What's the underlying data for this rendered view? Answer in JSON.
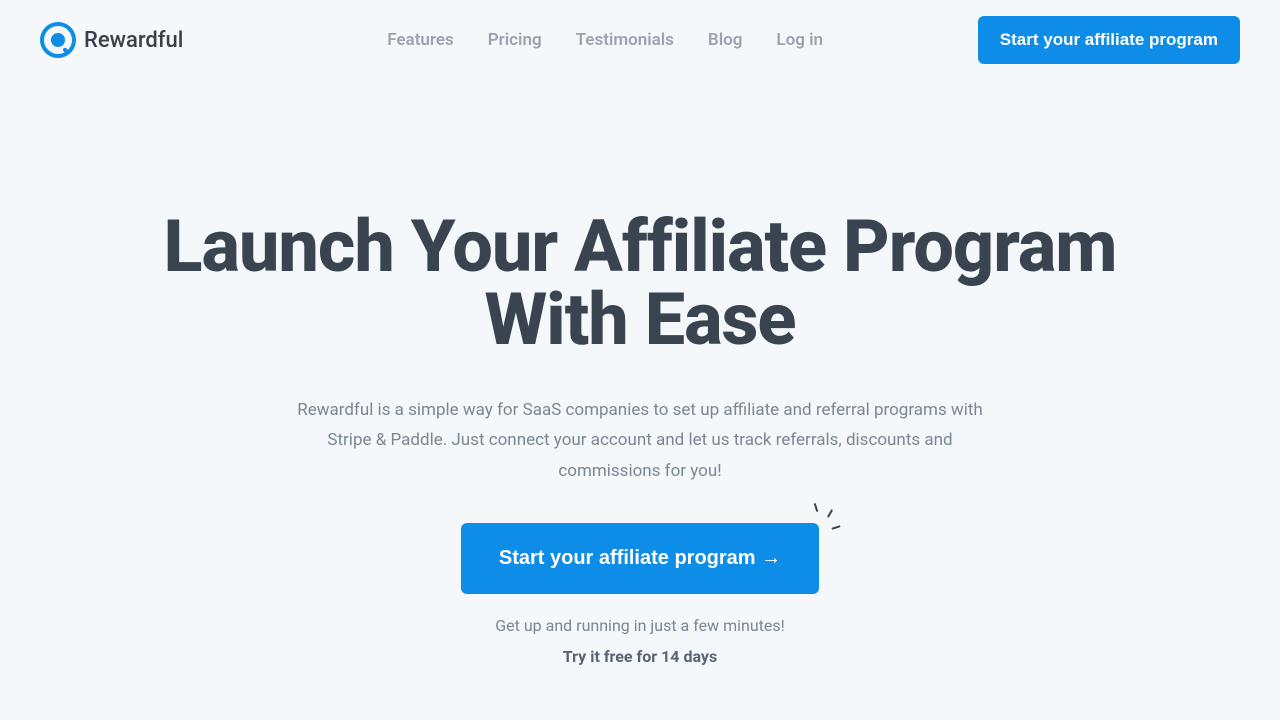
{
  "brand": {
    "name": "Rewardful"
  },
  "nav": {
    "items": [
      {
        "label": "Features"
      },
      {
        "label": "Pricing"
      },
      {
        "label": "Testimonials"
      },
      {
        "label": "Blog"
      },
      {
        "label": "Log in"
      }
    ]
  },
  "header": {
    "cta_label": "Start your affiliate program"
  },
  "hero": {
    "title": "Launch Your Affiliate Program With Ease",
    "subtitle": "Rewardful is a simple way for SaaS companies to set up affiliate and referral programs with Stripe & Paddle. Just connect your account and let us track referrals, discounts and commissions for you!",
    "cta_label": "Start your affiliate program →",
    "note1": "Get up and running in just a few minutes!",
    "note2": "Try it free for 14 days"
  }
}
